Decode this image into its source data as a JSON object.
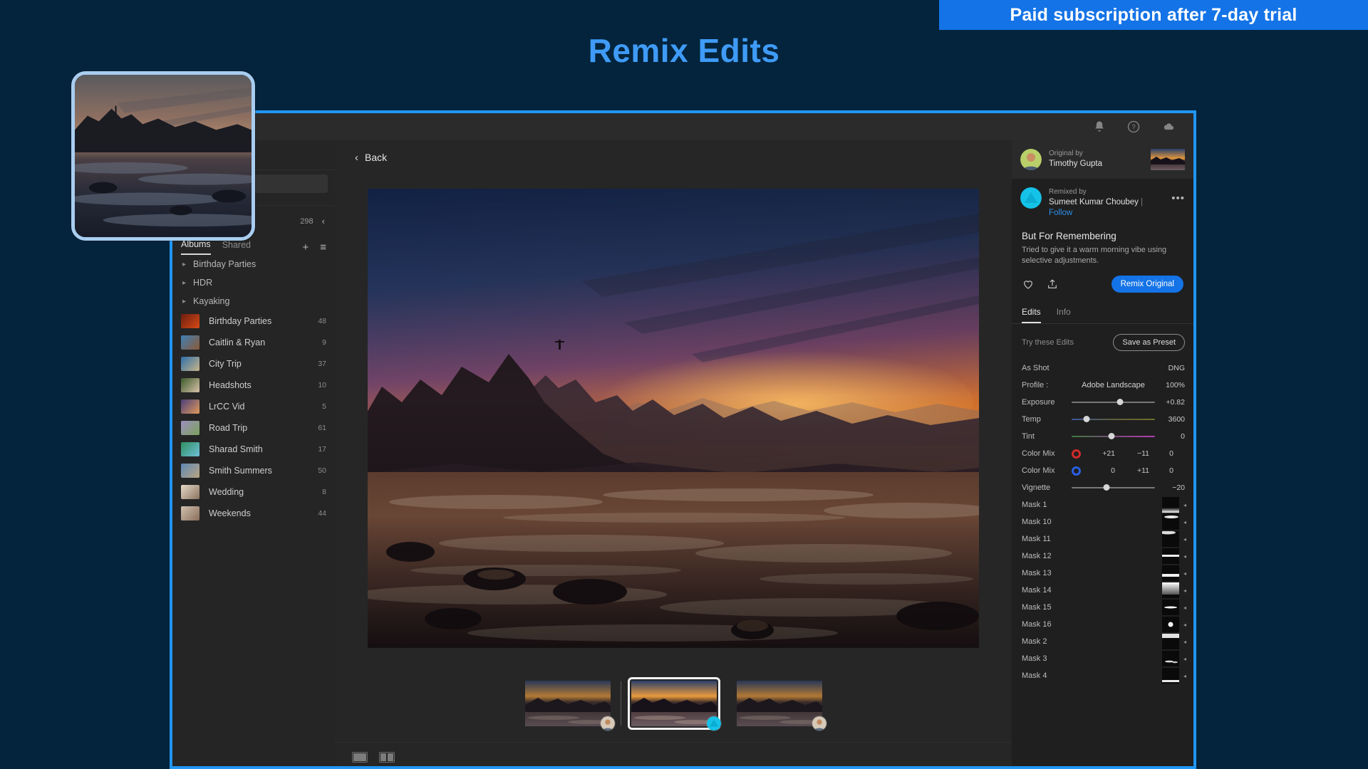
{
  "annotations": {
    "banner_text": "Paid subscription after 7-day trial",
    "title": "Remix Edits",
    "banner_color": "#1473e6",
    "title_color": "#3f9bf7",
    "highlight_color": "#2196f3"
  },
  "titlebar": {
    "icons": [
      "bell-icon",
      "help-icon",
      "cloud-icon"
    ]
  },
  "sidebar": {
    "photo_count": "298",
    "collapse_chevron": "‹",
    "tabs": [
      {
        "label": "Albums",
        "active": true
      },
      {
        "label": "Shared",
        "active": false
      }
    ],
    "add_icon": "plus-icon",
    "sort_icon": "sort-icon",
    "groups": [
      {
        "label": "Birthday Parties"
      },
      {
        "label": "HDR"
      },
      {
        "label": "Kayaking"
      }
    ],
    "albums": [
      {
        "name": "Birthday Parties",
        "count": "48",
        "c1": "#6b1d10",
        "c2": "#d94a16"
      },
      {
        "name": "Caitlin & Ryan",
        "count": "9",
        "c1": "#3f7fb5",
        "c2": "#8c5a38"
      },
      {
        "name": "City Trip",
        "count": "37",
        "c1": "#2f6fa8",
        "c2": "#c8b48a"
      },
      {
        "name": "Headshots",
        "count": "10",
        "c1": "#3c5a2c",
        "c2": "#d8c2a8"
      },
      {
        "name": "LrCC Vid",
        "count": "5",
        "c1": "#4b3f7a",
        "c2": "#e0995a"
      },
      {
        "name": "Road Trip",
        "count": "61",
        "c1": "#9d8fbf",
        "c2": "#7aa25c"
      },
      {
        "name": "Sharad Smith",
        "count": "17",
        "c1": "#2f8f5f",
        "c2": "#6fc0d8"
      },
      {
        "name": "Smith Summers",
        "count": "50",
        "c1": "#5f88b5",
        "c2": "#b9a480"
      },
      {
        "name": "Wedding",
        "count": "8",
        "c1": "#e6d8c8",
        "c2": "#8c7560"
      },
      {
        "name": "Weekends",
        "count": "44",
        "c1": "#cfc0ae",
        "c2": "#8a6f5c"
      }
    ]
  },
  "center": {
    "back_label": "Back",
    "back_chevron": "‹",
    "view_icons": [
      "single-view-icon",
      "compare-view-icon"
    ],
    "filmstrip": [
      {
        "selected": false,
        "badge": "photo-avatar"
      },
      {
        "selected": true,
        "badge": "remix-avatar"
      },
      {
        "selected": false,
        "badge": "photo-avatar"
      }
    ]
  },
  "right_panel": {
    "original": {
      "label": "Original by",
      "name": "Timothy Gupta"
    },
    "remixed": {
      "label": "Remixed by",
      "name": "Sumeet Kumar Choubey",
      "separator": "|",
      "follow_label": "Follow",
      "more_icon": "•••"
    },
    "post": {
      "title": "But For Remembering",
      "description": "Tried to give it a warm morning vibe using selective adjustments."
    },
    "actions": {
      "like_icon": "heart-icon",
      "share_icon": "share-icon",
      "remix_button": "Remix Original"
    },
    "tabs": [
      {
        "label": "Edits",
        "active": true
      },
      {
        "label": "Info",
        "active": false
      }
    ],
    "edits_header": {
      "try_label": "Try these Edits",
      "save_preset_label": "Save as Preset"
    },
    "edits": [
      {
        "name": "As Shot",
        "kind": "text",
        "value": "DNG"
      },
      {
        "name": "Profile :",
        "kind": "profile",
        "mid": "Adobe Landscape",
        "value": "100%"
      },
      {
        "name": "Exposure",
        "kind": "slider",
        "value": "+0.82",
        "pos": 58,
        "track": "plain"
      },
      {
        "name": "Temp",
        "kind": "slider",
        "value": "3600",
        "pos": 18,
        "track": "temp"
      },
      {
        "name": "Tint",
        "kind": "slider",
        "value": "0",
        "pos": 48,
        "track": "tint"
      },
      {
        "name": "Color Mix",
        "kind": "colormix",
        "swatch": "#d02a2a",
        "a": "+21",
        "b": "−11",
        "value": "0"
      },
      {
        "name": "Color Mix",
        "kind": "colormix",
        "swatch": "#2a5fe0",
        "a": "0",
        "b": "+11",
        "value": "0"
      },
      {
        "name": "Vignette",
        "kind": "slider",
        "value": "−20",
        "pos": 42,
        "track": "plain"
      }
    ],
    "masks": [
      {
        "name": "Mask 1",
        "pattern": "bottom-glow"
      },
      {
        "name": "Mask 10",
        "pattern": "top-streak"
      },
      {
        "name": "Mask 11",
        "pattern": "upper-streak"
      },
      {
        "name": "Mask 12",
        "pattern": "mid-band"
      },
      {
        "name": "Mask 13",
        "pattern": "lower-band"
      },
      {
        "name": "Mask 14",
        "pattern": "full-bright"
      },
      {
        "name": "Mask 15",
        "pattern": "thin-line"
      },
      {
        "name": "Mask 16",
        "pattern": "dot"
      },
      {
        "name": "Mask 2",
        "pattern": "top-bright"
      },
      {
        "name": "Mask 3",
        "pattern": "speckle"
      },
      {
        "name": "Mask 4",
        "pattern": "bottom-band"
      }
    ],
    "mask_arrow": "◂"
  }
}
